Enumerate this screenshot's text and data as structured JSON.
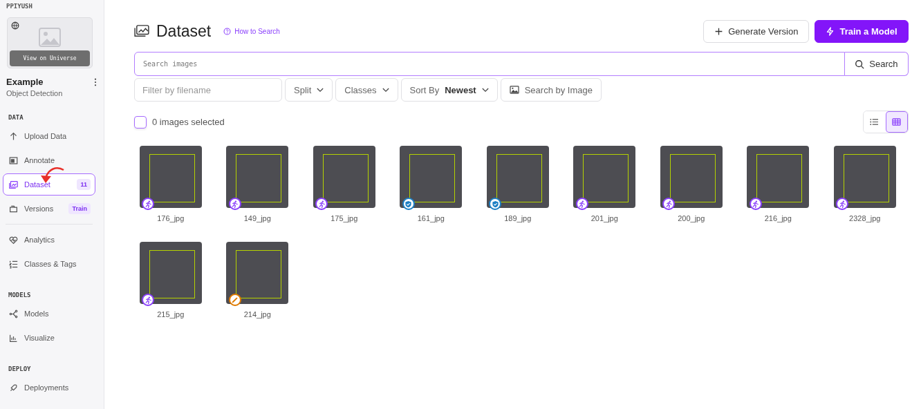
{
  "workspace": {
    "name": "PPIYUSH"
  },
  "project": {
    "preview_button": "View on Universe",
    "name": "Example",
    "type": "Object Detection"
  },
  "sidebar": {
    "sections": [
      {
        "heading": "DATA",
        "items": [
          {
            "kind": "upload",
            "label": "Upload Data",
            "selected": false
          },
          {
            "kind": "annotate",
            "label": "Annotate",
            "selected": false
          },
          {
            "kind": "dataset",
            "label": "Dataset",
            "selected": true,
            "badge": "11"
          },
          {
            "kind": "versions",
            "label": "Versions",
            "selected": false,
            "badge": "Train"
          },
          {
            "kind": "divider"
          },
          {
            "kind": "analytics",
            "label": "Analytics",
            "selected": false
          },
          {
            "kind": "classes",
            "label": "Classes & Tags",
            "selected": false
          }
        ]
      },
      {
        "heading": "MODELS",
        "items": [
          {
            "kind": "models",
            "label": "Models",
            "selected": false
          },
          {
            "kind": "visualize",
            "label": "Visualize",
            "selected": false
          }
        ]
      },
      {
        "heading": "DEPLOY",
        "items": [
          {
            "kind": "deploy",
            "label": "Deployments",
            "selected": false
          }
        ]
      }
    ]
  },
  "header": {
    "title": "Dataset",
    "help_link": "How to Search",
    "buttons": [
      {
        "kind": "secondary",
        "label": "Generate Version"
      },
      {
        "kind": "primary",
        "label": "Train a Model"
      }
    ]
  },
  "search": {
    "placeholder": "Search images",
    "button": "Search"
  },
  "filters": {
    "filename_placeholder": "Filter by filename",
    "split": "Split",
    "classes": "Classes",
    "sort_label": "Sort By",
    "sort_value": "Newest",
    "image_search": "Search by Image"
  },
  "selection": {
    "label": "0 images selected",
    "checked": false
  },
  "view_toggle": [
    {
      "kind": "list",
      "selected": false
    },
    {
      "kind": "grid",
      "selected": true
    }
  ],
  "images": [
    {
      "name": "176_jpg",
      "kind": "run"
    },
    {
      "name": "149_jpg",
      "kind": "run"
    },
    {
      "name": "175_jpg",
      "kind": "run"
    },
    {
      "name": "161_jpg",
      "kind": "shield"
    },
    {
      "name": "189_jpg",
      "kind": "shield"
    },
    {
      "name": "201_jpg",
      "kind": "run"
    },
    {
      "name": "200_jpg",
      "kind": "run"
    },
    {
      "name": "216_jpg",
      "kind": "run"
    },
    {
      "name": "2328_jpg",
      "kind": "run"
    },
    {
      "name": "215_jpg",
      "kind": "run"
    },
    {
      "name": "214_jpg",
      "kind": "pencil"
    }
  ]
}
